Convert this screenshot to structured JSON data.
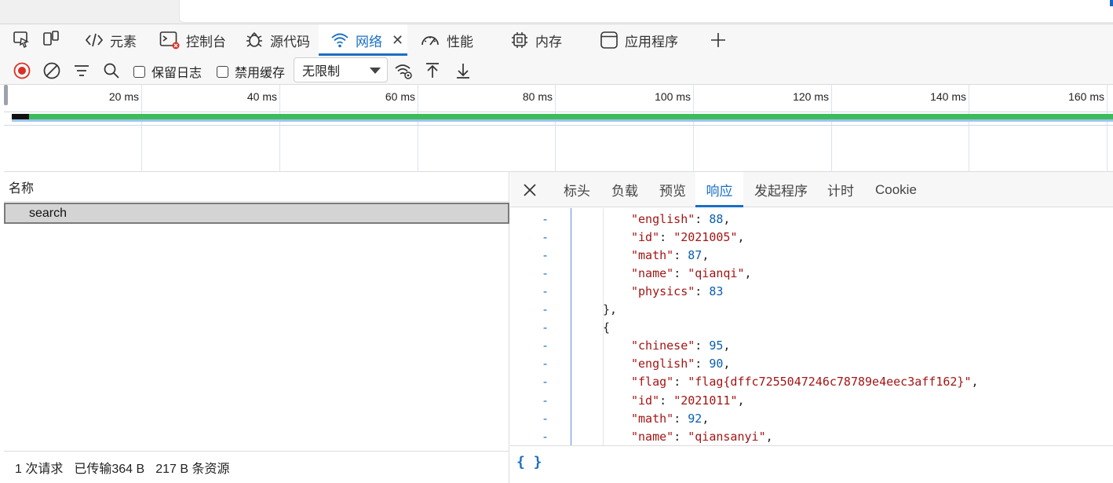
{
  "devtools_tabs": {
    "elements": "元素",
    "console": "控制台",
    "sources": "源代码",
    "network": "网络",
    "performance": "性能",
    "memory": "内存",
    "application": "应用程序"
  },
  "toolbar": {
    "preserve_log": "保留日志",
    "disable_cache": "禁用缓存",
    "throttle_value": "无限制"
  },
  "overview": {
    "ticks": [
      "20 ms",
      "40 ms",
      "60 ms",
      "80 ms",
      "100 ms",
      "120 ms",
      "140 ms",
      "160 ms"
    ]
  },
  "request_list": {
    "column_name": "名称",
    "rows": [
      "search"
    ]
  },
  "status": {
    "requests": "1 次请求",
    "transferred": "已传输364 B",
    "resources": "217 B 条资源"
  },
  "detail_tabs": {
    "headers": "标头",
    "payload": "负载",
    "preview": "预览",
    "response": "响应",
    "initiator": "发起程序",
    "timing": "计时",
    "cookie": "Cookie"
  },
  "response_lines": [
    {
      "key": "english",
      "value": "88",
      "type": "num",
      "comma": true
    },
    {
      "key": "id",
      "value": "2021005",
      "type": "str",
      "comma": true
    },
    {
      "key": "math",
      "value": "87",
      "type": "num",
      "comma": true
    },
    {
      "key": "name",
      "value": "qianqi",
      "type": "str",
      "comma": true
    },
    {
      "key": "physics",
      "value": "83",
      "type": "num",
      "comma": false
    },
    {
      "raw": "},"
    },
    {
      "raw": "{"
    },
    {
      "key": "chinese",
      "value": "95",
      "type": "num",
      "comma": true
    },
    {
      "key": "english",
      "value": "90",
      "type": "num",
      "comma": true
    },
    {
      "key": "flag",
      "value": "flag{dffc7255047246c78789e4eec3aff162}",
      "type": "str",
      "comma": true
    },
    {
      "key": "id",
      "value": "2021011",
      "type": "str",
      "comma": true
    },
    {
      "key": "math",
      "value": "92",
      "type": "num",
      "comma": true
    },
    {
      "key": "name",
      "value": "qiansanyi",
      "type": "str",
      "comma": true
    }
  ],
  "footer": {
    "pretty_print": "{ }"
  }
}
